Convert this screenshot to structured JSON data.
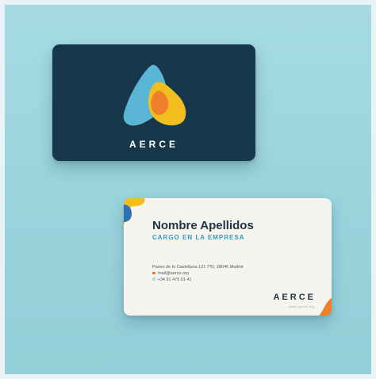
{
  "front_card": {
    "brand": "AERCE",
    "colors": {
      "card": "#17374a",
      "logo_blue": "#5bb6d6",
      "logo_yellow": "#f2bd1f",
      "logo_orange": "#ef7f2a"
    }
  },
  "back_card": {
    "name": "Nombre Apellidos",
    "role": "CARGO EN LA EMPRESA",
    "address": "Paseo de la Castellana 121 7ºD, 28046 Madrid",
    "email": "mail@aerce.org",
    "phone": "+34 91 475 01 41",
    "brand": "AERCE",
    "web": "www.aerce.org",
    "colors": {
      "card": "#f6f4ef",
      "name": "#1c3446",
      "role": "#2f9ec2",
      "accent": "#ef7f2a"
    }
  },
  "icons": [
    "logo-mark-icon",
    "email-icon",
    "phone-icon"
  ]
}
